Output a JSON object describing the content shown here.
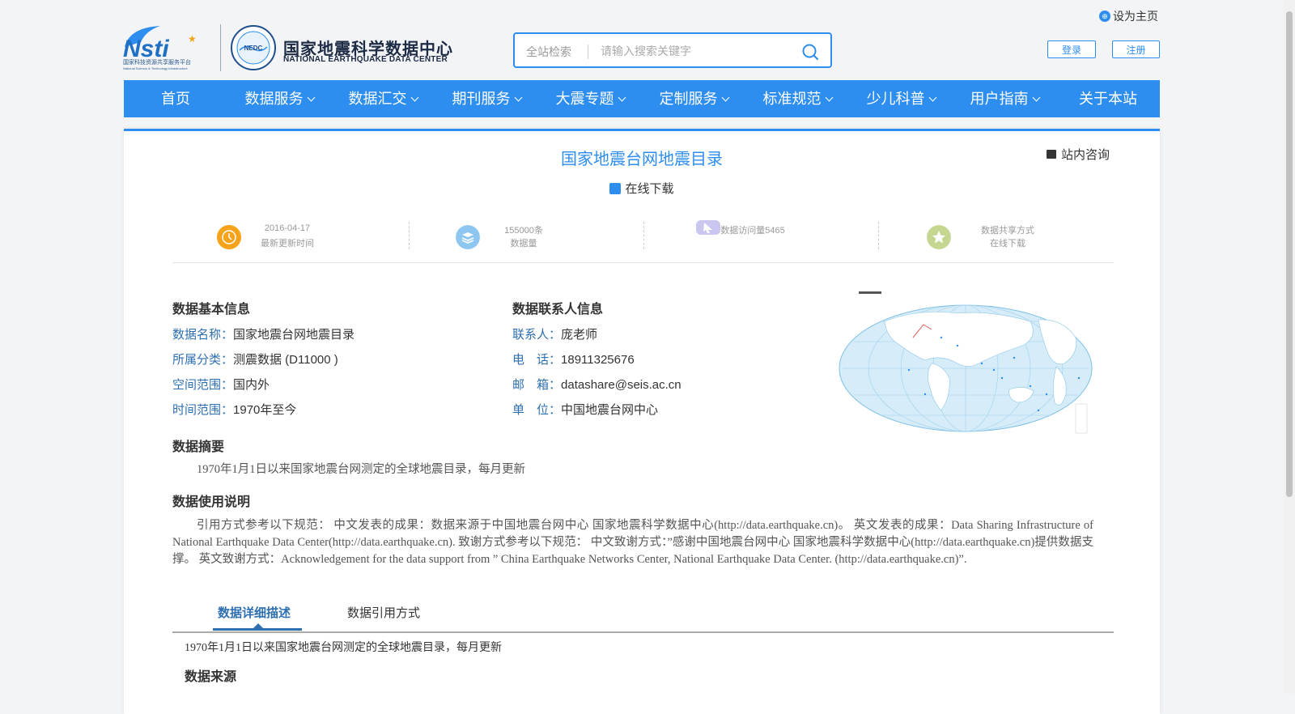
{
  "top": {
    "set_home": "设为主页",
    "login": "登录",
    "register": "注册"
  },
  "logo": {
    "cn": "国家地震科学数据中心",
    "en": "NATIONAL EARTHQUAKE DATA CENTER",
    "nsti": "Nsti",
    "nsti_sub": "国家科技资源共享服务平台",
    "nsti_sub_en": "National Science & Technology Infrastructure",
    "ndc": "NEDC"
  },
  "search": {
    "scope": "全站检索",
    "placeholder": "请输入搜索关键字"
  },
  "nav": [
    {
      "label": "首页",
      "caret": false
    },
    {
      "label": "数据服务",
      "caret": true
    },
    {
      "label": "数据汇交",
      "caret": true
    },
    {
      "label": "期刊服务",
      "caret": true
    },
    {
      "label": "大震专题",
      "caret": true
    },
    {
      "label": "定制服务",
      "caret": true
    },
    {
      "label": "标准规范",
      "caret": true
    },
    {
      "label": "少儿科普",
      "caret": true
    },
    {
      "label": "用户指南",
      "caret": true
    },
    {
      "label": "关于本站",
      "caret": false
    }
  ],
  "dataset": {
    "title": "国家地震台网地震目录",
    "consult": "站内咨询",
    "download": "在线下载"
  },
  "stats": [
    {
      "line1": "2016-04-17",
      "line2": "最新更新时间",
      "color": "#f7a21b",
      "icon": "clock-icon"
    },
    {
      "line1": "155000条",
      "line2": "数据量",
      "color": "#8ec6f2",
      "icon": "layers-icon"
    },
    {
      "line1": "数据访问量5465",
      "line2": "",
      "color": "#c9c7f0",
      "icon": "cursor-icon"
    },
    {
      "line1": "数据共享方式",
      "line2": "在线下载",
      "color": "#c4d68f",
      "icon": "star-icon"
    }
  ],
  "basic": {
    "heading": "数据基本信息",
    "rows": [
      {
        "label": "数据名称：",
        "value": "国家地震台网地震目录"
      },
      {
        "label": "所属分类：",
        "value": "测震数据 (D11000 )"
      },
      {
        "label": "空间范围：",
        "value": "国内外"
      },
      {
        "label": "时间范围：",
        "value": "1970年至今"
      }
    ]
  },
  "contact": {
    "heading": "数据联系人信息",
    "rows": [
      {
        "label": "联系人：",
        "value": "庞老师"
      },
      {
        "label": "电　话：",
        "value": "18911325676"
      },
      {
        "label": "邮　箱：",
        "value": "datashare@seis.ac.cn"
      },
      {
        "label": "单　位：",
        "value": "中国地震台网中心"
      }
    ]
  },
  "abstract": {
    "heading": "数据摘要",
    "text": "1970年1月1日以来国家地震台网测定的全球地震目录，每月更新"
  },
  "usage": {
    "heading": "数据使用说明",
    "text": "引用方式参考以下规范： 中文发表的成果：数据来源于中国地震台网中心 国家地震科学数据中心(http://data.earthquake.cn)。 英文发表的成果：Data Sharing Infrastructure of National Earthquake Data Center(http://data.earthquake.cn). 致谢方式参考以下规范： 中文致谢方式：”感谢中国地震台网中心 国家地震科学数据中心(http://data.earthquake.cn)提供数据支撑。 英文致谢方式：Acknowledgement for the data support from ” China Earthquake Networks Center, National Earthquake Data Center. (http://data.earthquake.cn)”."
  },
  "tabs": [
    {
      "label": "数据详细描述",
      "active": true
    },
    {
      "label": "数据引用方式",
      "active": false
    }
  ],
  "detail": {
    "text": "1970年1月1日以来国家地震台网测定的全球地震目录，每月更新",
    "source_heading": "数据来源"
  }
}
